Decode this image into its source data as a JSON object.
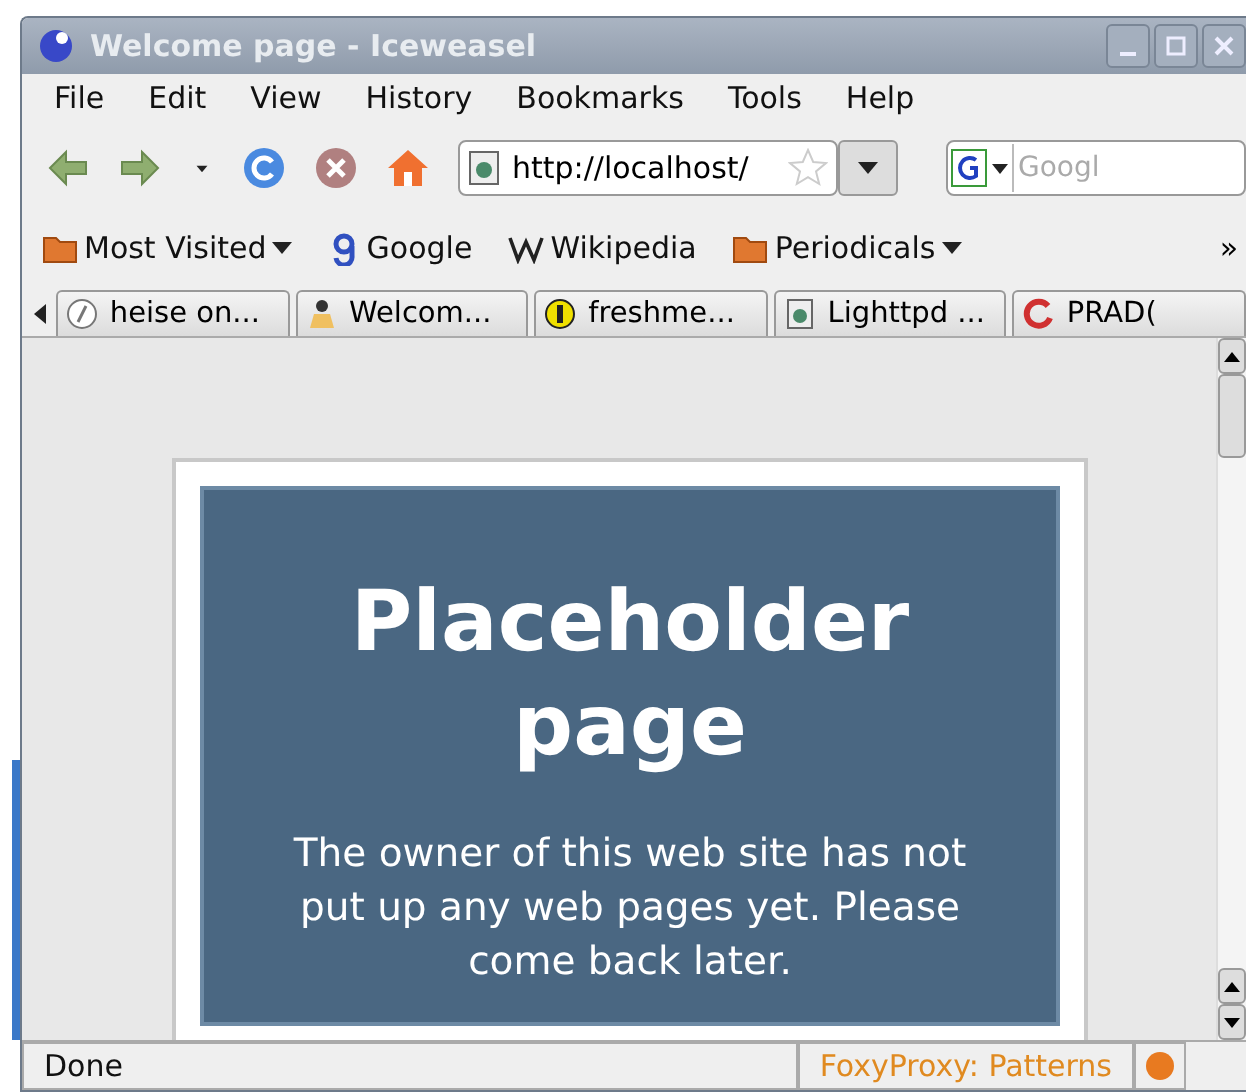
{
  "window": {
    "title": "Welcome page - Iceweasel"
  },
  "menu": [
    "File",
    "Edit",
    "View",
    "History",
    "Bookmarks",
    "Tools",
    "Help"
  ],
  "address": {
    "value": "http://localhost/"
  },
  "search": {
    "placeholder": "Googl"
  },
  "bookmarks": [
    {
      "label": "Most Visited",
      "kind": "folder-menu"
    },
    {
      "label": "Google",
      "kind": "google"
    },
    {
      "label": "Wikipedia",
      "kind": "wiki"
    },
    {
      "label": "Periodicals",
      "kind": "folder-menu"
    }
  ],
  "overflow": "»",
  "tabs": [
    {
      "label": "heise on...",
      "kind": "heise"
    },
    {
      "label": "Welcom...",
      "kind": "person"
    },
    {
      "label": "freshme...",
      "kind": "fresh"
    },
    {
      "label": "Lighttpd ...",
      "kind": "page"
    },
    {
      "label": "PRAD(",
      "kind": "prado"
    }
  ],
  "page": {
    "heading": "Placeholder page",
    "message": "The owner of this web site has not put up any web pages yet. Please come back later."
  },
  "status_bar": {
    "text": "Done",
    "proxy": "FoxyProxy: Patterns"
  }
}
